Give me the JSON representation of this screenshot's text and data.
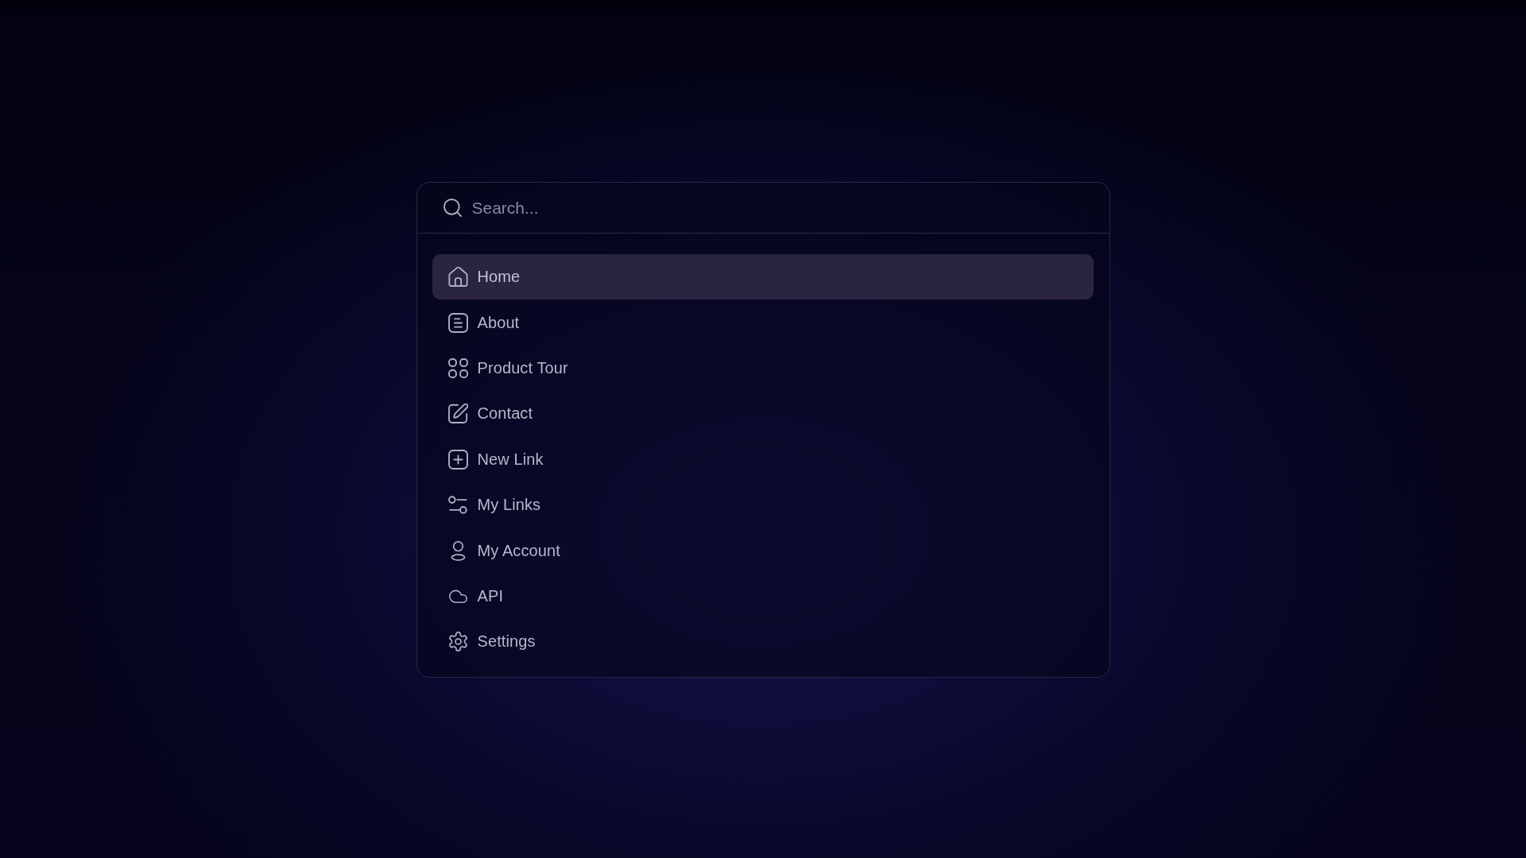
{
  "search": {
    "placeholder": "Search..."
  },
  "menu": {
    "items": [
      {
        "label": "Home",
        "selected": true
      },
      {
        "label": "About",
        "selected": false
      },
      {
        "label": "Product Tour",
        "selected": false
      },
      {
        "label": "Contact",
        "selected": false
      },
      {
        "label": "New Link",
        "selected": false
      },
      {
        "label": "My Links",
        "selected": false
      },
      {
        "label": "My Account",
        "selected": false
      },
      {
        "label": "API",
        "selected": false
      },
      {
        "label": "Settings",
        "selected": false
      }
    ]
  }
}
